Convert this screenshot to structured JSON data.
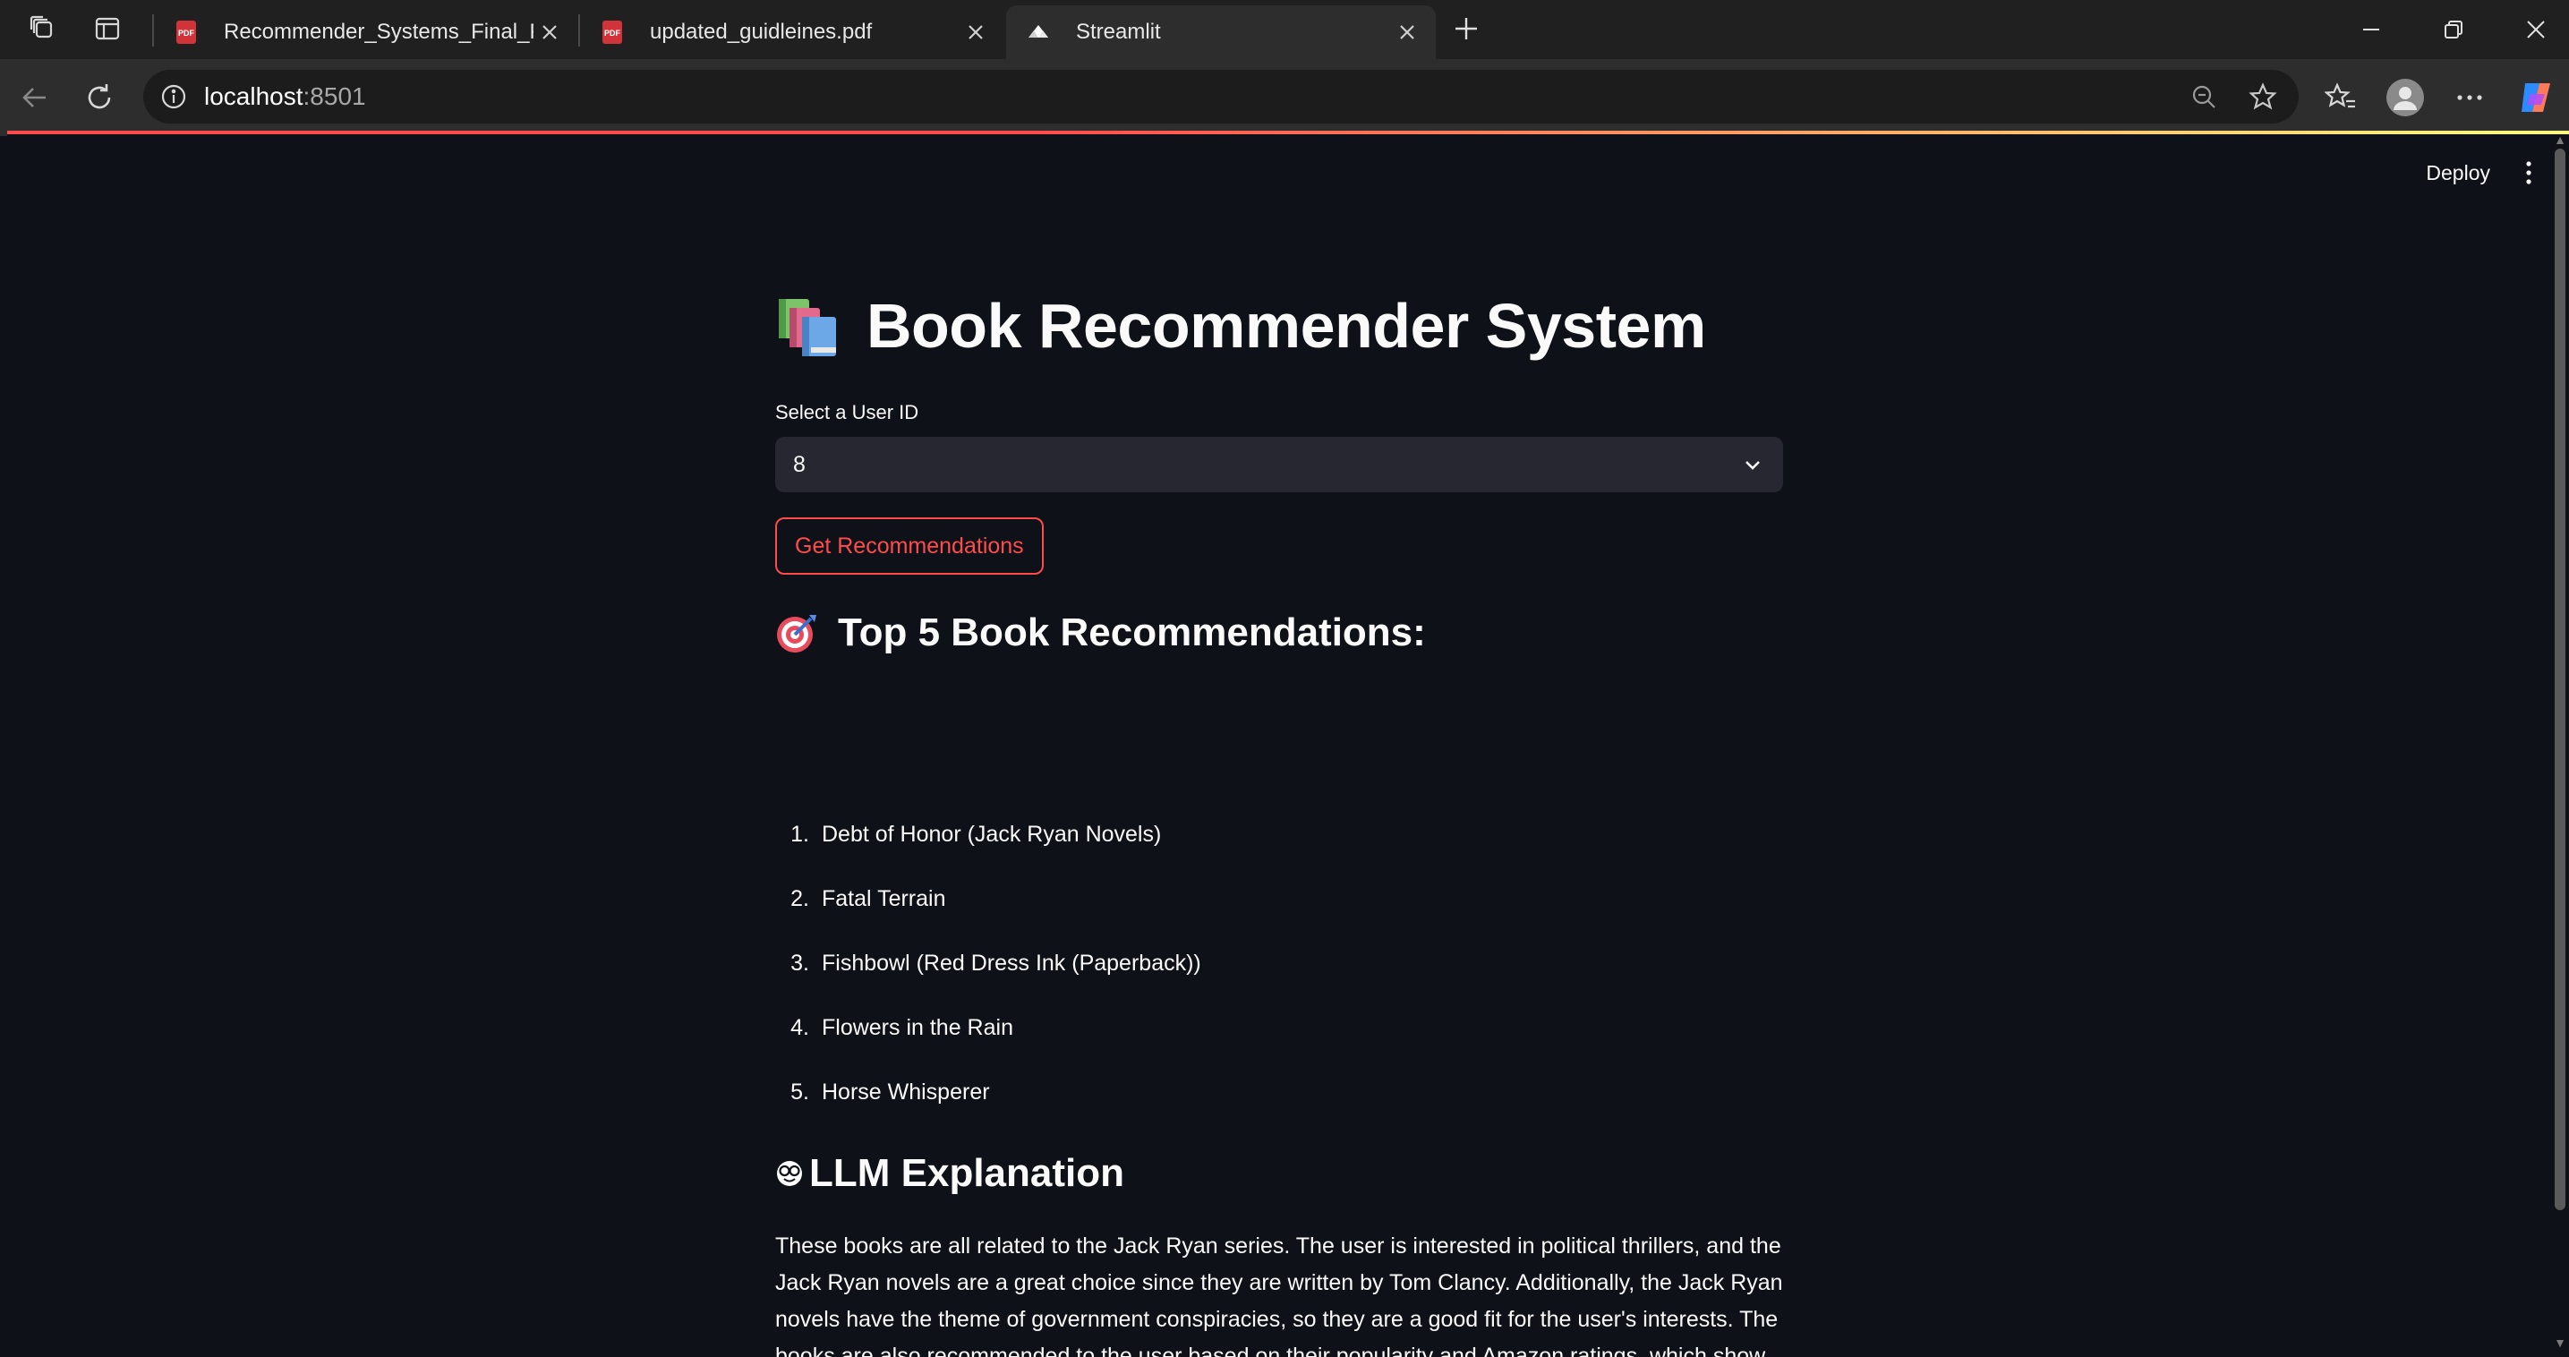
{
  "browser": {
    "tabs": [
      {
        "title": "Recommender_Systems_Final_Pro",
        "favicon": "pdf-icon",
        "active": false
      },
      {
        "title": "updated_guidleines.pdf",
        "favicon": "pdf-icon",
        "active": false
      },
      {
        "title": "Streamlit",
        "favicon": "streamlit-icon",
        "active": true
      }
    ],
    "url_host": "localhost",
    "url_port": ":8501"
  },
  "app": {
    "deploy_label": "Deploy",
    "title": "Book Recommender System",
    "title_icon": "books-emoji",
    "select": {
      "label": "Select a User ID",
      "value": "8"
    },
    "button_label": "Get Recommendations",
    "recommendations_heading": "Top 5 Book Recommendations:",
    "recommendations_icon": "dart-target-emoji",
    "recommendations": [
      {
        "num": "1.",
        "title": "Debt of Honor (Jack Ryan Novels)"
      },
      {
        "num": "2.",
        "title": "Fatal Terrain"
      },
      {
        "num": "3.",
        "title": "Fishbowl (Red Dress Ink (Paperback))"
      },
      {
        "num": "4.",
        "title": "Flowers in the Rain"
      },
      {
        "num": "5.",
        "title": "Horse Whisperer"
      }
    ],
    "explanation_heading": "LLM Explanation",
    "explanation_icon": "nerd-face-emoji",
    "explanation_text": "These books are all related to the Jack Ryan series. The user is interested in political thrillers, and the Jack Ryan novels are a great choice since they are written by Tom Clancy. Additionally, the Jack Ryan novels have the theme of government conspiracies, so they are a good fit for the user's interests. The books are also recommended to the user based on their popularity and Amazon ratings, which show that they are well-liked by other users."
  },
  "colors": {
    "background": "#0e1117",
    "accent": "#ff4b4b",
    "select_bg": "#262730"
  }
}
